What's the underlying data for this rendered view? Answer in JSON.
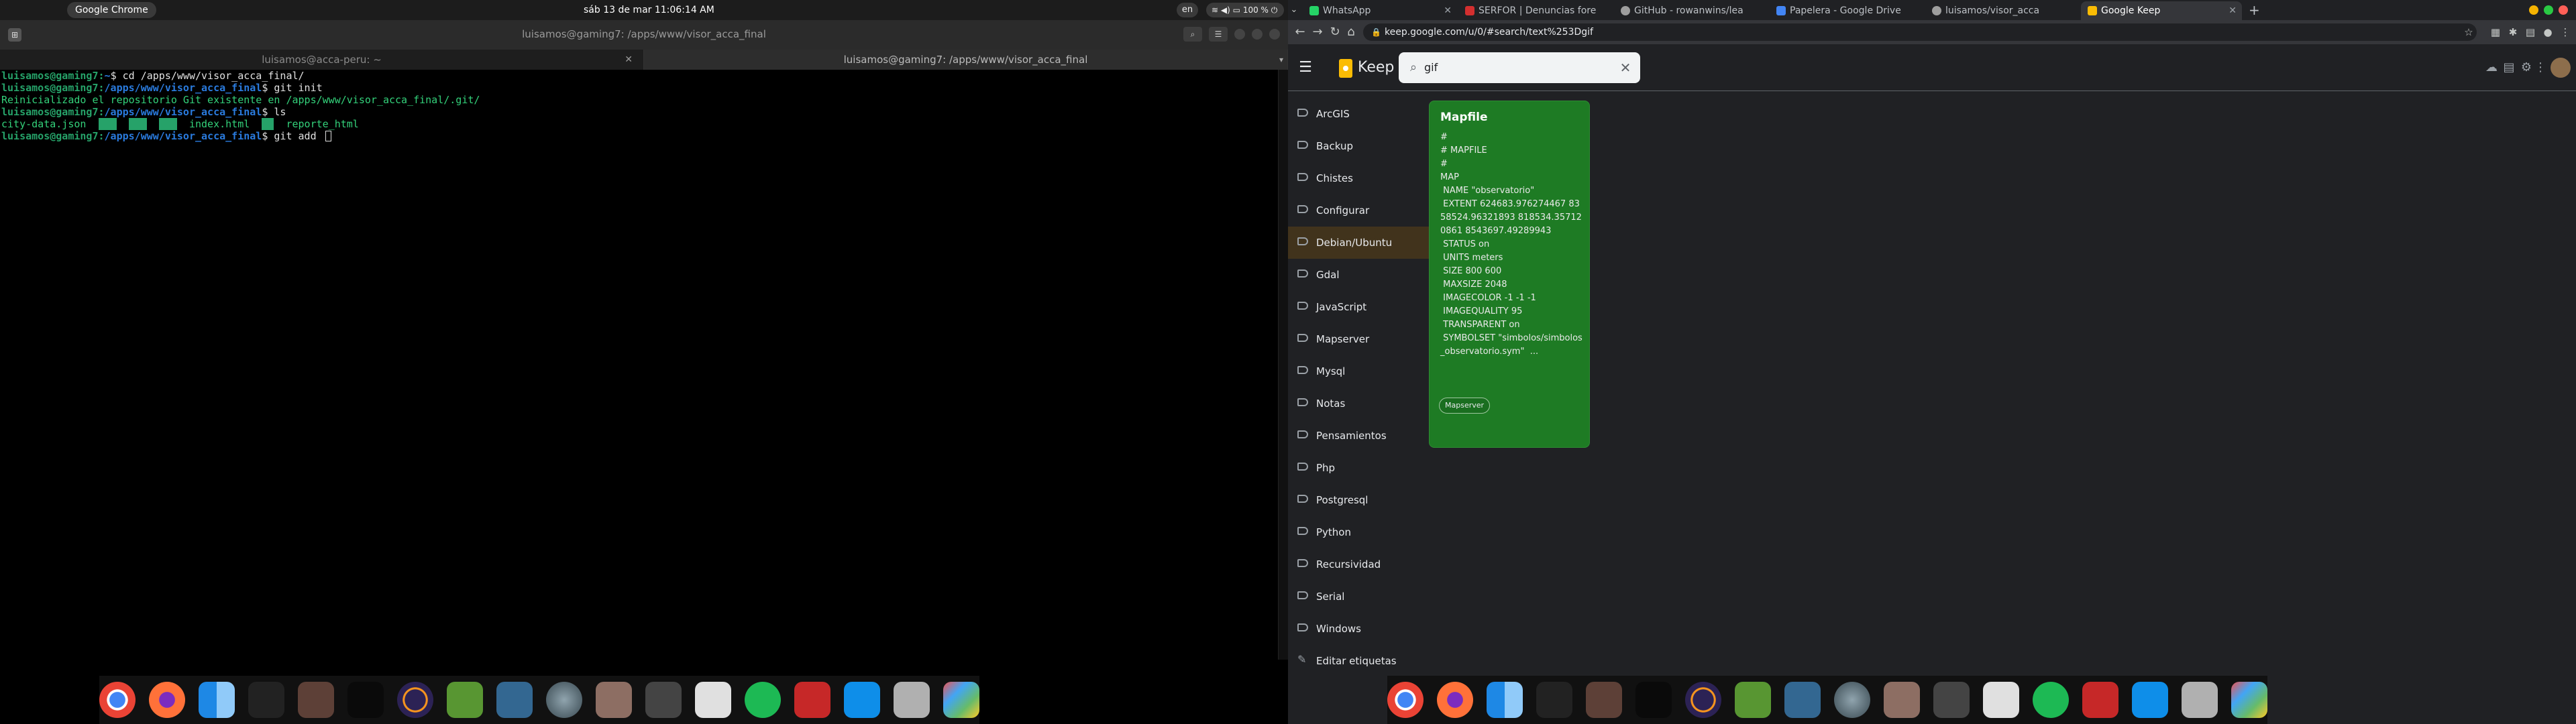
{
  "left": {
    "topbar": {
      "active_app": "Google Chrome",
      "clock": "sáb 13 de mar  11:06:14 AM",
      "lang": "en",
      "battery": "100 %"
    },
    "terminal": {
      "title": "luisamos@gaming7: /apps/www/visor_acca_final",
      "tabs": [
        {
          "label": "luisamos@acca-peru: ~"
        },
        {
          "label": "luisamos@gaming7: /apps/www/visor_acca_final"
        }
      ],
      "lines": {
        "l1_user": "luisamos@gaming7:",
        "l1_path": "~",
        "l1_cmd": "$ cd /apps/www/visor_acca_final/",
        "l2_user": "luisamos@gaming7:",
        "l2_path": "/apps/www/visor_acca_final",
        "l2_cmd": "$ git init",
        "l3_out": "Reinicializado el repositorio Git existente en /apps/www/visor_acca_final/.git/",
        "l4_user": "luisamos@gaming7:",
        "l4_path": "/apps/www/visor_acca_final",
        "l4_cmd": "$ ls",
        "l5_f1": "city-data.json",
        "l5_f2": "index.html",
        "l5_f3": "reporte_html",
        "l6_user": "luisamos@gaming7:",
        "l6_path": "/apps/www/visor_acca_final",
        "l6_cmd": "$ git add "
      }
    },
    "dock_icons": [
      "chrome-icon",
      "firefox-icon",
      "finder-icon",
      "terminal-icon",
      "editor-icon",
      "vscode-icon",
      "eclipse-icon",
      "qgis-icon",
      "postgres-icon",
      "globe-icon",
      "image-viewer-icon",
      "inkscape-icon",
      "filezilla-icon",
      "spotify-icon",
      "gmail-icon",
      "teamviewer-icon",
      "trash-icon",
      "launchpad-icon"
    ]
  },
  "right": {
    "tabs": [
      {
        "label": "WhatsApp",
        "color": "#25d366"
      },
      {
        "label": "SERFOR | Denuncias fore",
        "color": "#d32f2f"
      },
      {
        "label": "GitHub - rowanwins/lea",
        "color": "#9e9e9e"
      },
      {
        "label": "Papelera - Google Drive",
        "color": "#4285f4"
      },
      {
        "label": "luisamos/visor_acca",
        "color": "#9e9e9e"
      },
      {
        "label": "Google Keep",
        "color": "#fbbc04"
      }
    ],
    "url": "keep.google.com/u/0/#search/text%253Dgif",
    "keep": {
      "app_name": "Keep",
      "search_value": "gif",
      "labels": [
        {
          "name": "ArcGIS",
          "active": false
        },
        {
          "name": "Backup",
          "active": false
        },
        {
          "name": "Chistes",
          "active": false
        },
        {
          "name": "Configurar",
          "active": false
        },
        {
          "name": "Debian/Ubuntu",
          "active": true
        },
        {
          "name": "Gdal",
          "active": false
        },
        {
          "name": "JavaScript",
          "active": false
        },
        {
          "name": "Mapserver",
          "active": false
        },
        {
          "name": "Mysql",
          "active": false
        },
        {
          "name": "Notas",
          "active": false
        },
        {
          "name": "Pensamientos",
          "active": false
        },
        {
          "name": "Php",
          "active": false
        },
        {
          "name": "Postgresql",
          "active": false
        },
        {
          "name": "Python",
          "active": false
        },
        {
          "name": "Recursividad",
          "active": false
        },
        {
          "name": "Serial",
          "active": false
        },
        {
          "name": "Windows",
          "active": false
        }
      ],
      "edit_labels": "Editar etiquetas",
      "note": {
        "title": "Mapfile",
        "body": "#\n# MAPFILE\n#\nMAP\n NAME \"observatorio\"\n EXTENT 624683.976274467 8358524.96321893 818534.357120861 8543697.49289943\n STATUS on\n UNITS meters\n SIZE 800 600\n MAXSIZE 2048\n IMAGECOLOR -1 -1 -1\n IMAGEQUALITY 95\n TRANSPARENT on\n SYMBOLSET \"simbolos/simbolos_observatorio.sym\"  ...",
        "label": "Mapserver",
        "color": "#1e7b24"
      }
    }
  }
}
